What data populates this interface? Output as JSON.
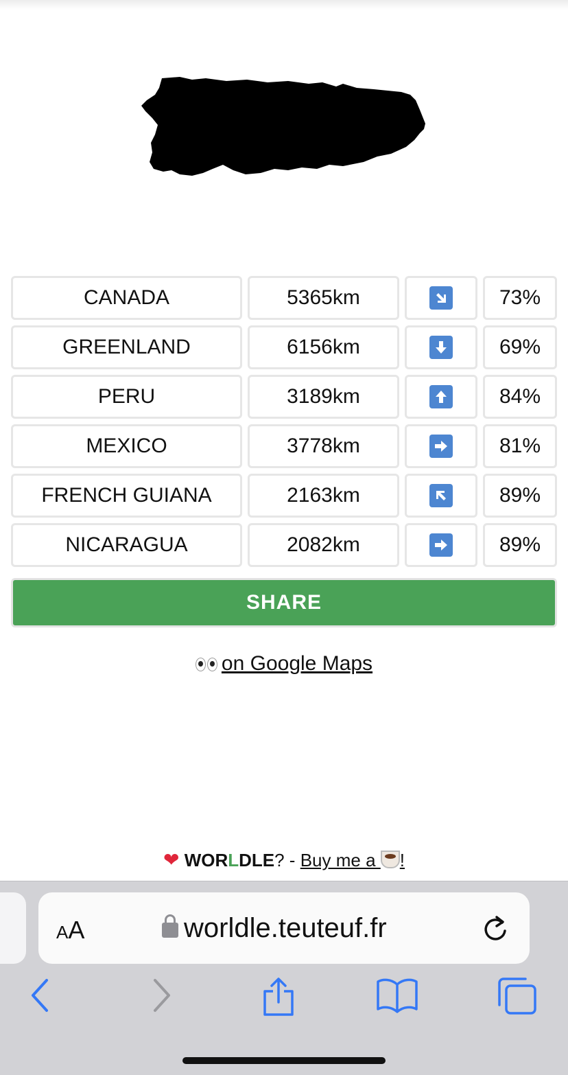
{
  "game": {
    "guesses": [
      {
        "country": "CANADA",
        "distance": "5365km",
        "direction": "south-east",
        "proximity": "73%"
      },
      {
        "country": "GREENLAND",
        "distance": "6156km",
        "direction": "south",
        "proximity": "69%"
      },
      {
        "country": "PERU",
        "distance": "3189km",
        "direction": "north",
        "proximity": "84%"
      },
      {
        "country": "MEXICO",
        "distance": "3778km",
        "direction": "east",
        "proximity": "81%"
      },
      {
        "country": "FRENCH GUIANA",
        "distance": "2163km",
        "direction": "north-west",
        "proximity": "89%"
      },
      {
        "country": "NICARAGUA",
        "distance": "2082km",
        "direction": "east",
        "proximity": "89%"
      }
    ],
    "share_label": "SHARE",
    "maps_link": "on Google Maps"
  },
  "footer": {
    "brand_a": "WOR",
    "brand_b": "L",
    "brand_c": "DLE",
    "mid": "? - ",
    "buy": "Buy me a ",
    "excl": "!"
  },
  "browser": {
    "url": "worldle.teuteuf.fr",
    "text_size_big": "A",
    "text_size_small": "A"
  },
  "colors": {
    "share_bg": "#4aa257",
    "arrow_bg": "#4d86d1",
    "browser_tint": "#3478f6"
  }
}
